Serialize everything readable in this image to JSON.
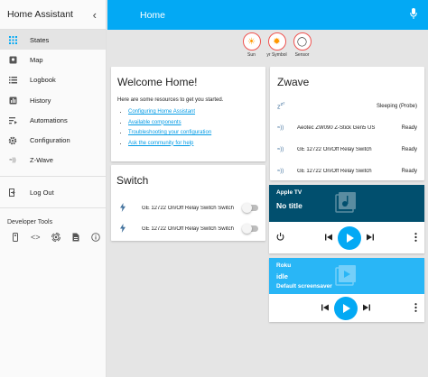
{
  "sidebar": {
    "title": "Home Assistant",
    "collapse_glyph": "‹",
    "items": [
      {
        "label": "States",
        "icon": "grid-icon"
      },
      {
        "label": "Map",
        "icon": "map-icon"
      },
      {
        "label": "Logbook",
        "icon": "logbook-icon"
      },
      {
        "label": "History",
        "icon": "history-icon"
      },
      {
        "label": "Automations",
        "icon": "automations-icon"
      },
      {
        "label": "Configuration",
        "icon": "gear-icon"
      },
      {
        "label": "Z-Wave",
        "icon": "zwave-icon"
      }
    ],
    "logout": "Log Out",
    "dev_tools_title": "Developer Tools",
    "dev_tools": [
      "remote-icon",
      "code-icon",
      "broadcast-icon",
      "file-icon",
      "info-icon"
    ]
  },
  "header": {
    "title": "Home",
    "accent": "#03a9f4"
  },
  "badges": [
    {
      "label": "Sun",
      "glyph": "☀"
    },
    {
      "label": "yr Symbol",
      "glyph": "✹"
    },
    {
      "label": "Sensor",
      "glyph": "◯"
    }
  ],
  "welcome": {
    "title": "Welcome Home!",
    "intro": "Here are some resources to get you started.",
    "links": [
      "Configuring Home Assistant",
      "Available components",
      "Troubleshooting your configuration",
      "Ask the community for help"
    ]
  },
  "switch": {
    "title": "Switch",
    "items": [
      "GE 12722 On/Off Relay Switch Switch",
      "GE 12722 On/Off Relay Switch Switch"
    ]
  },
  "zwave": {
    "title": "Zwave",
    "rows": [
      {
        "name": "",
        "state": "Sleeping (Probe)"
      },
      {
        "name": "Aeotec ZW090 Z-Stick Gen5 US",
        "state": "Ready"
      },
      {
        "name": "GE 12722 On/Off Relay Switch",
        "state": "Ready"
      },
      {
        "name": "GE 12722 On/Off Relay Switch",
        "state": "Ready"
      }
    ]
  },
  "media": {
    "appletv": {
      "name": "Apple TV",
      "title": "No title",
      "color": "#014f6e"
    },
    "roku": {
      "name": "Roku",
      "title": "idle",
      "subtitle": "Default screensaver",
      "color": "#29b6f6"
    }
  }
}
